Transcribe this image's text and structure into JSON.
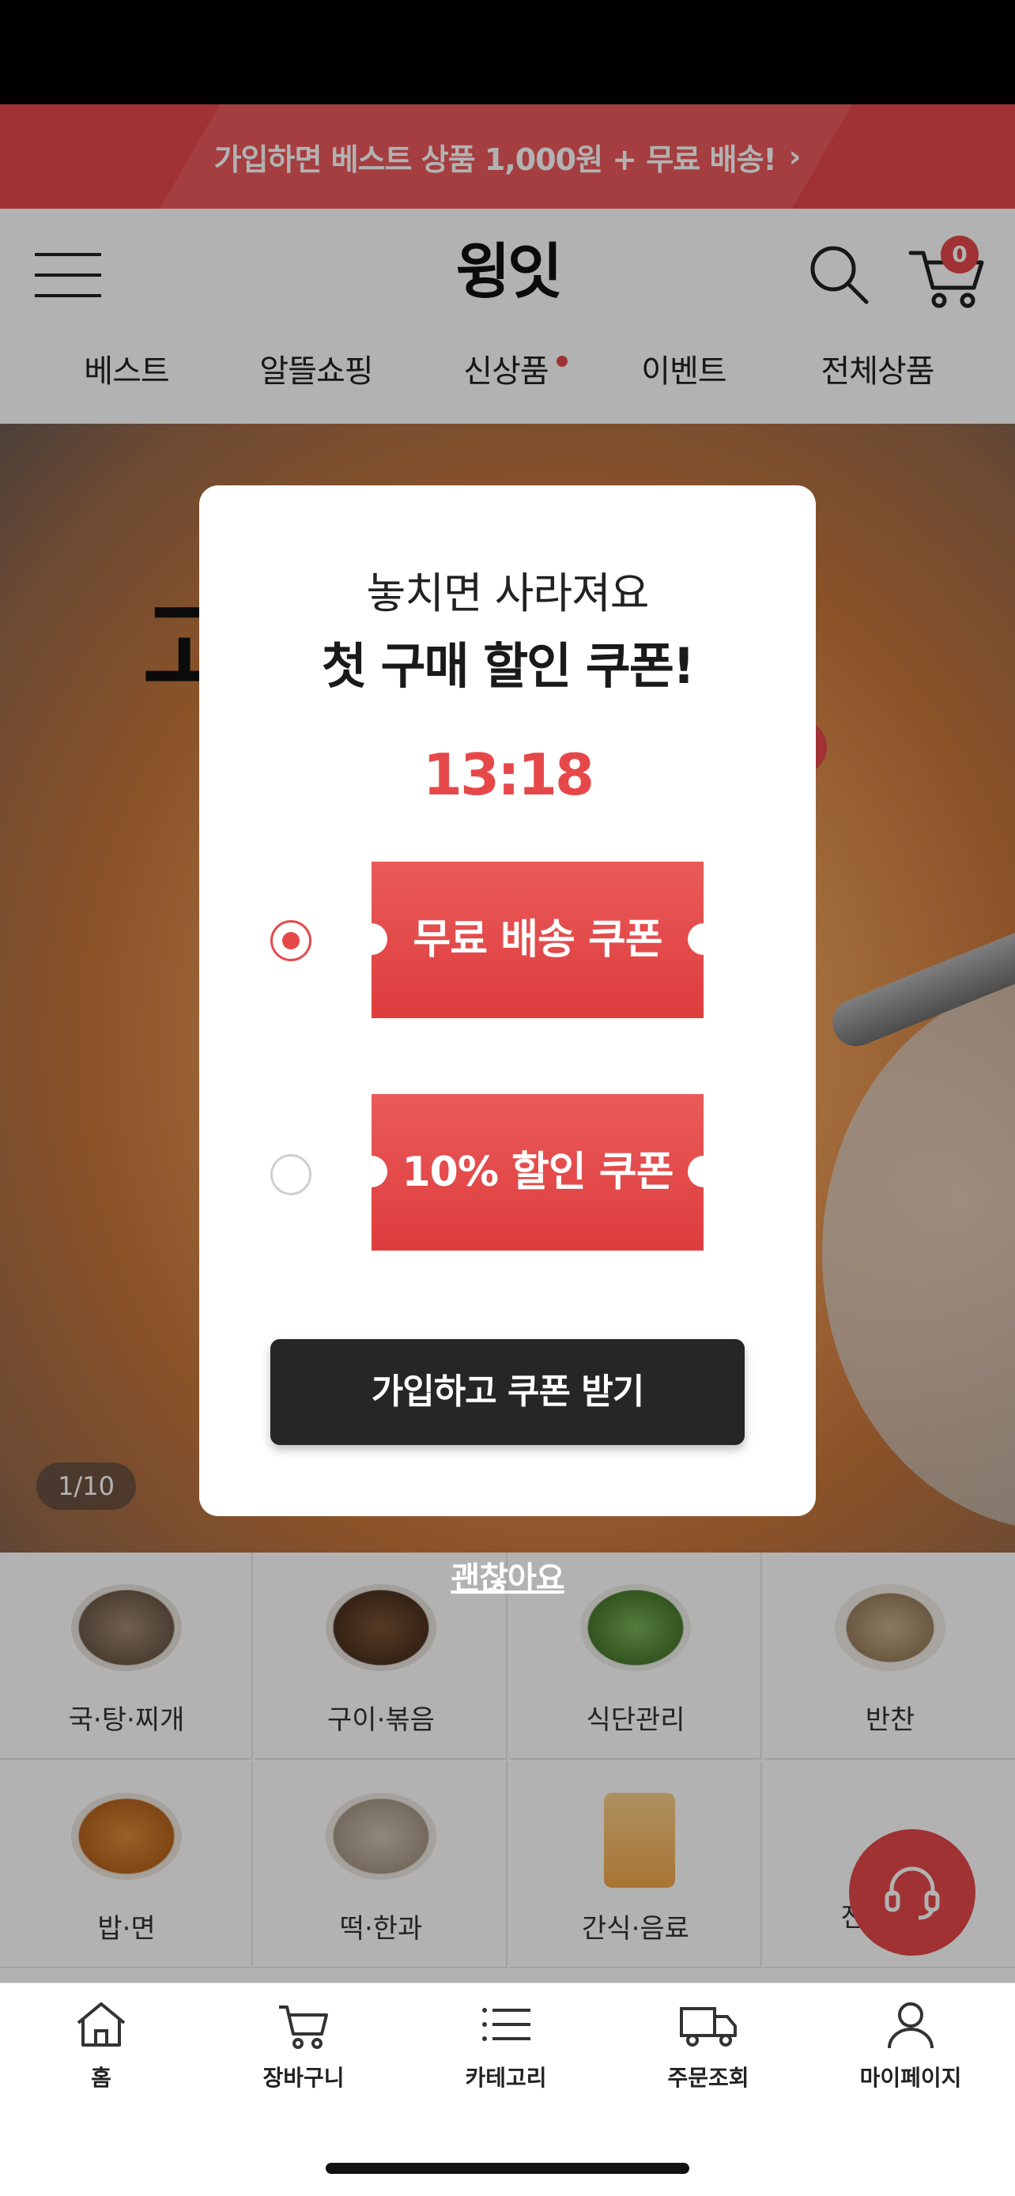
{
  "promo_banner": {
    "text": "가입하면 베스트 상품 1,000원 + 무료 배송!",
    "chevron": "›"
  },
  "header": {
    "logo": "윙잇",
    "cart_count": "0",
    "nav": [
      "베스트",
      "알뜰쇼핑",
      "신상품",
      "이벤트",
      "전체상품"
    ]
  },
  "hero": {
    "pager": "1/10"
  },
  "categories": [
    {
      "label": "국·탕·찌개",
      "color": "#8a7565"
    },
    {
      "label": "구이·볶음",
      "color": "#6b4a2e"
    },
    {
      "label": "식단관리",
      "color": "#5f8f45"
    },
    {
      "label": "반찬",
      "color": "#b9a07a"
    },
    {
      "label": "밥·면",
      "color": "#c7782f"
    },
    {
      "label": "떡·한과",
      "color": "#b7a99a"
    },
    {
      "label": "간식·음료",
      "color": "#f2b25a"
    },
    {
      "label": "전체보기",
      "color": "#ffffff"
    }
  ],
  "modal": {
    "subtitle": "놓치면 사라져요",
    "title": "첫 구매 할인 쿠폰!",
    "timer": "13:18",
    "coupons": [
      {
        "label": "무료 배송 쿠폰",
        "selected": true
      },
      {
        "label": "10% 할인 쿠폰",
        "selected": false
      }
    ],
    "cta": "가입하고 쿠폰 받기",
    "dismiss": "괜찮아요"
  },
  "tabbar": [
    "홈",
    "장바구니",
    "카테고리",
    "주문조회",
    "마이페이지"
  ],
  "colors": {
    "accent": "#e6484a",
    "dark_button": "#262626"
  }
}
